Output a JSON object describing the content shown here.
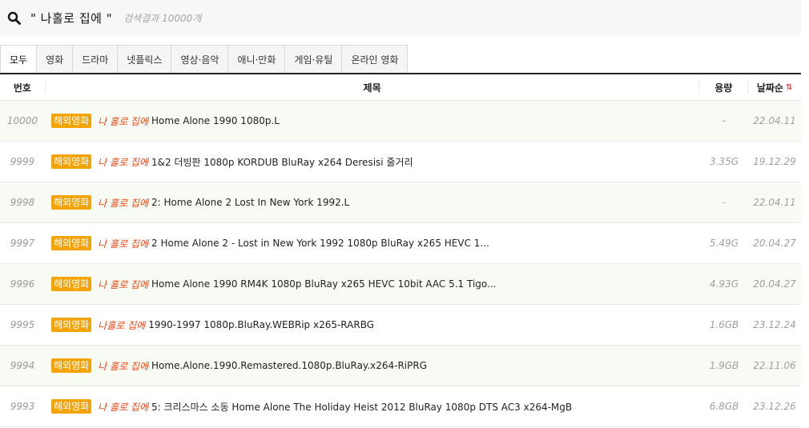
{
  "search": {
    "icon": "search-icon",
    "query": "\" 나홀로 집에 \"",
    "result_count": "검색결과 10000개"
  },
  "tabs": [
    {
      "label": "모두",
      "active": true
    },
    {
      "label": "영화"
    },
    {
      "label": "드라마"
    },
    {
      "label": "넷플릭스"
    },
    {
      "label": "영상·음악"
    },
    {
      "label": "애니·만화"
    },
    {
      "label": "게임·유틸"
    },
    {
      "label": "온라인 영화"
    }
  ],
  "table": {
    "headers": {
      "num": "번호",
      "title": "제목",
      "size": "용량",
      "date": "날짜순"
    },
    "sort_icon": "sort-icon",
    "rows": [
      {
        "num": "10000",
        "badge": "해외영화",
        "keyword": "나 홀로 집에",
        "title": "Home Alone 1990 1080p.L",
        "size": "-",
        "date": "22.04.11"
      },
      {
        "num": "9999",
        "badge": "해외영화",
        "keyword": "나 홀로 집에",
        "title": "1&2 더빙판 1080p KORDUB BluRay x264 Deresisi 줄거리",
        "size": "3.35G",
        "date": "19.12.29"
      },
      {
        "num": "9998",
        "badge": "해외영화",
        "keyword": "나 홀로 집에",
        "title": "2: Home Alone 2 Lost In New York 1992.L",
        "size": "-",
        "date": "22.04.11"
      },
      {
        "num": "9997",
        "badge": "해외영화",
        "keyword": "나 홀로 집에",
        "title": "2 Home Alone 2 - Lost in New York 1992 1080p BluRay x265 HEVC 1...",
        "size": "5.49G",
        "date": "20.04.27"
      },
      {
        "num": "9996",
        "badge": "해외영화",
        "keyword": "나 홀로 집에",
        "title": "Home Alone 1990 RM4K 1080p BluRay x265 HEVC 10bit AAC 5.1 Tigo...",
        "size": "4.93G",
        "date": "20.04.27"
      },
      {
        "num": "9995",
        "badge": "해외영화",
        "keyword": "나홀로 집에",
        "title": "1990-1997 1080p.BluRay.WEBRip x265-RARBG",
        "size": "1.6GB",
        "date": "23.12.24"
      },
      {
        "num": "9994",
        "badge": "해외영화",
        "keyword": "나 홀로 집에",
        "title": "Home.Alone.1990.Remastered.1080p.BluRay.x264-RiPRG",
        "size": "1.9GB",
        "date": "22.11.06"
      },
      {
        "num": "9993",
        "badge": "해외영화",
        "keyword": "나 홀로 집에",
        "title": "5: 크리스마스 소동 Home Alone The Holiday Heist 2012 BluRay 1080p DTS AC3 x264-MgB",
        "size": "6.8GB",
        "date": "23.12.26"
      }
    ]
  }
}
